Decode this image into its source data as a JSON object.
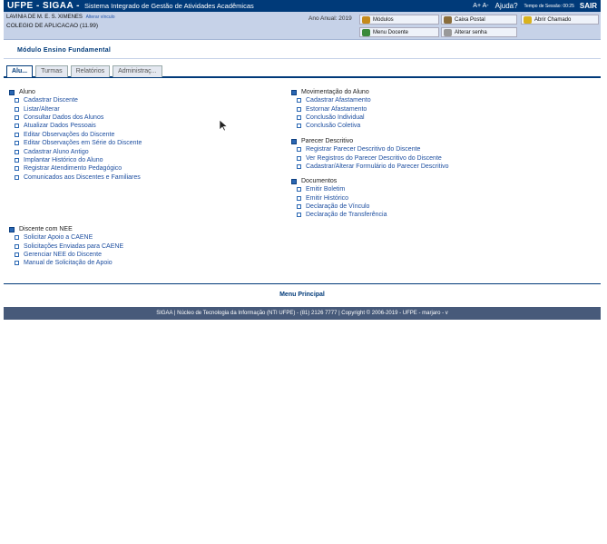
{
  "topbar": {
    "brand": "UFPE - SIGAA -",
    "system_name": "Sistema Integrado de Gestão de Atividades Acadêmicas",
    "font_controls": "A+ A-",
    "help": "Ajuda?",
    "timer": "Tempo de Sessão: 00:25",
    "logout": "SAIR"
  },
  "user": {
    "name": "LAVINIA DE M. E. S. XIMENES",
    "change_link": "Alterar vínculo",
    "unit": "COLEGIO DE APLICACAO (11.99)",
    "year": "Ano Anual: 2019"
  },
  "quick": {
    "modules": "Módulos",
    "mailbox": "Caixa Postal",
    "ticket": "Abrir Chamado",
    "teacher_menu": "Menu Docente",
    "change_password": "Alterar senha"
  },
  "module_title": "Módulo Ensino Fundamental",
  "tabs": [
    "Alu...",
    "Turmas",
    "Relatórios",
    "Administraç..."
  ],
  "left_sections": [
    {
      "title": "Aluno",
      "items": [
        "Cadastrar Discente",
        "Listar/Alterar",
        "Consultar Dados dos Alunos",
        "Atualizar Dados Pessoais",
        "Editar Observações do Discente",
        "Editar Observações em Série do Discente",
        "Cadastrar Aluno Antigo",
        "Implantar Histórico do Aluno",
        "Registrar Atendimento Pedagógico",
        "Comunicados aos Discentes e Familiares"
      ]
    },
    {
      "title": "Discente com NEE",
      "items": [
        "Solicitar Apoio a CAENE",
        "Solicitações Enviadas para CAENE",
        "Gerenciar NEE do Discente",
        "Manual de Solicitação de Apoio"
      ]
    }
  ],
  "right_sections": [
    {
      "title": "Movimentação do Aluno",
      "items": [
        "Cadastrar Afastamento",
        "Estornar Afastamento",
        "Conclusão Individual",
        "Conclusão Coletiva"
      ]
    },
    {
      "title": "Parecer Descritivo",
      "items": [
        "Registrar Parecer Descritivo do Discente",
        "Ver Registros do Parecer Descritivo do Discente",
        "Cadastrar/Alterar Formulário do Parecer Descritivo"
      ]
    },
    {
      "title": "Documentos",
      "items": [
        "Emitir Boletim",
        "Emitir Histórico",
        "Declaração de Vínculo",
        "Declaração de Transferência"
      ]
    }
  ],
  "menu_principal": "Menu Principal",
  "footer": "SIGAA | Núcleo de Tecnologia da Informação (NTI UFPE) - (81) 2126 7777 | Copyright © 2006-2019 - UFPE - marjaro - v",
  "colors": {
    "header": "#003a79",
    "infobar": "#c6d2e8",
    "link": "#1e4fa0",
    "footer": "#475a7a"
  }
}
